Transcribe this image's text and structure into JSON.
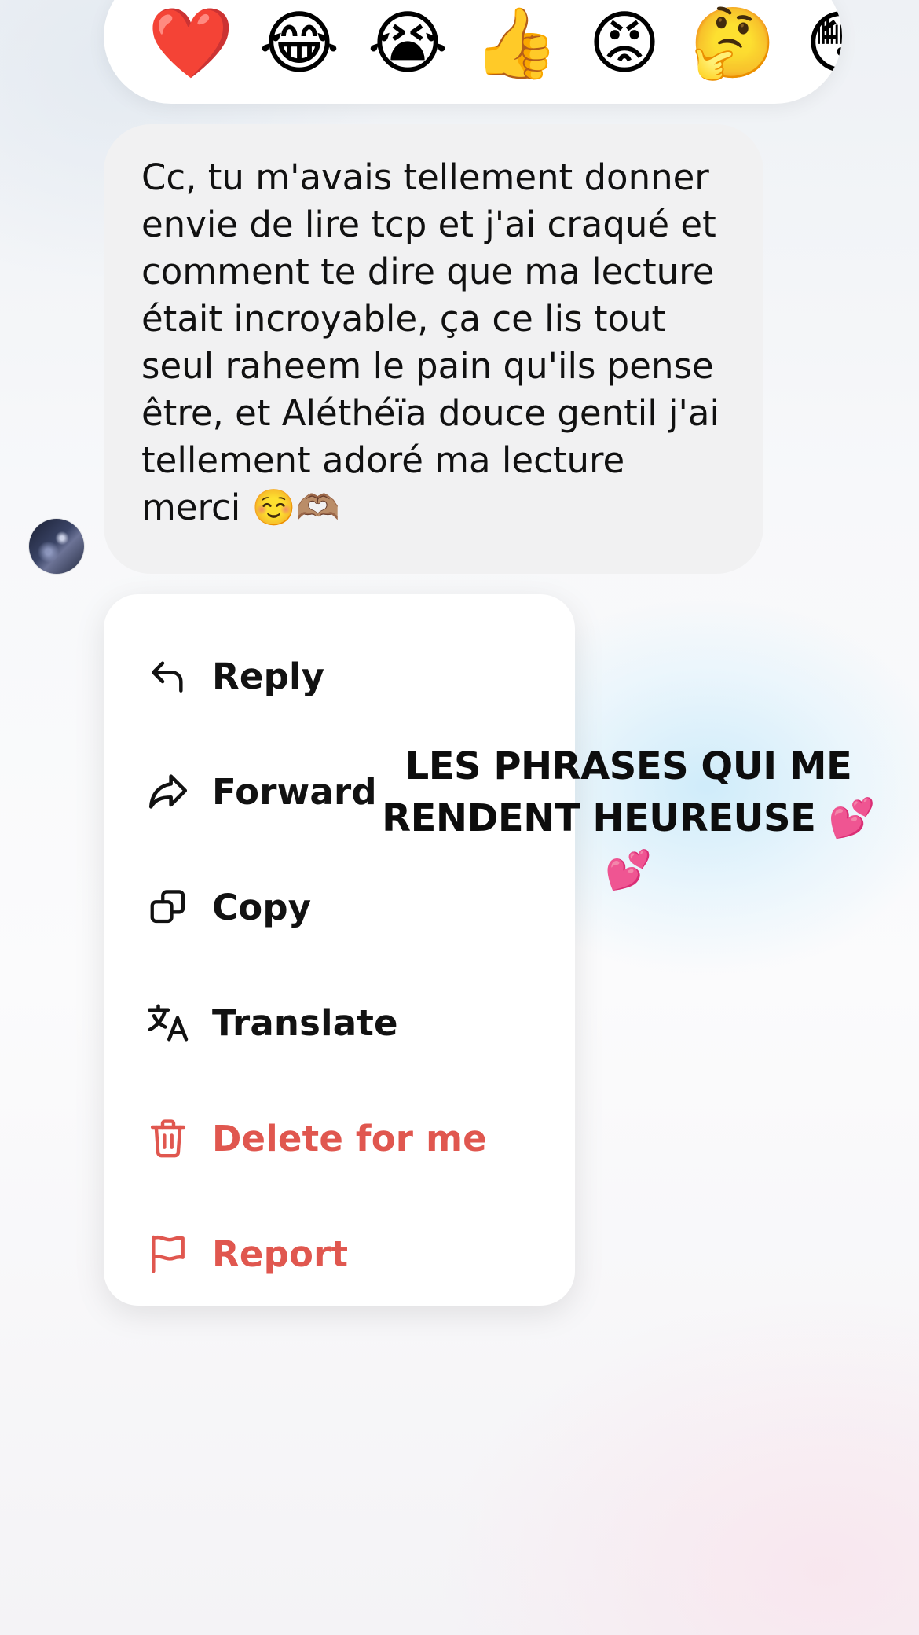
{
  "reactions": [
    {
      "emoji": "❤️",
      "name": "heart"
    },
    {
      "emoji": "😂",
      "name": "laughing"
    },
    {
      "emoji": "😭",
      "name": "crying"
    },
    {
      "emoji": "👍",
      "name": "thumbs-up"
    },
    {
      "emoji": "😡",
      "name": "angry"
    },
    {
      "emoji": "🤔",
      "name": "thinking"
    },
    {
      "emoji": "😳",
      "name": "flushed"
    }
  ],
  "message": {
    "text": "Cc, tu m'avais tellement donner envie de lire tcp et j'ai craqué et comment te dire que ma lecture était incroyable, ça ce lis tout seul raheem le pain qu'ils pense être, et Aléthéïa douce gentil j'ai tellement adoré ma lecture merci ☺️🫶🏽"
  },
  "menu": {
    "reply": "Reply",
    "forward": "Forward",
    "copy": "Copy",
    "translate": "Translate",
    "delete": "Delete for me",
    "report": "Report"
  },
  "colors": {
    "danger": "#e0574f",
    "bubble": "#f1f1f2",
    "text": "#121212"
  },
  "caption": {
    "text": "LES PHRASES QUI ME RENDENT HEUREUSE 💕💕"
  }
}
